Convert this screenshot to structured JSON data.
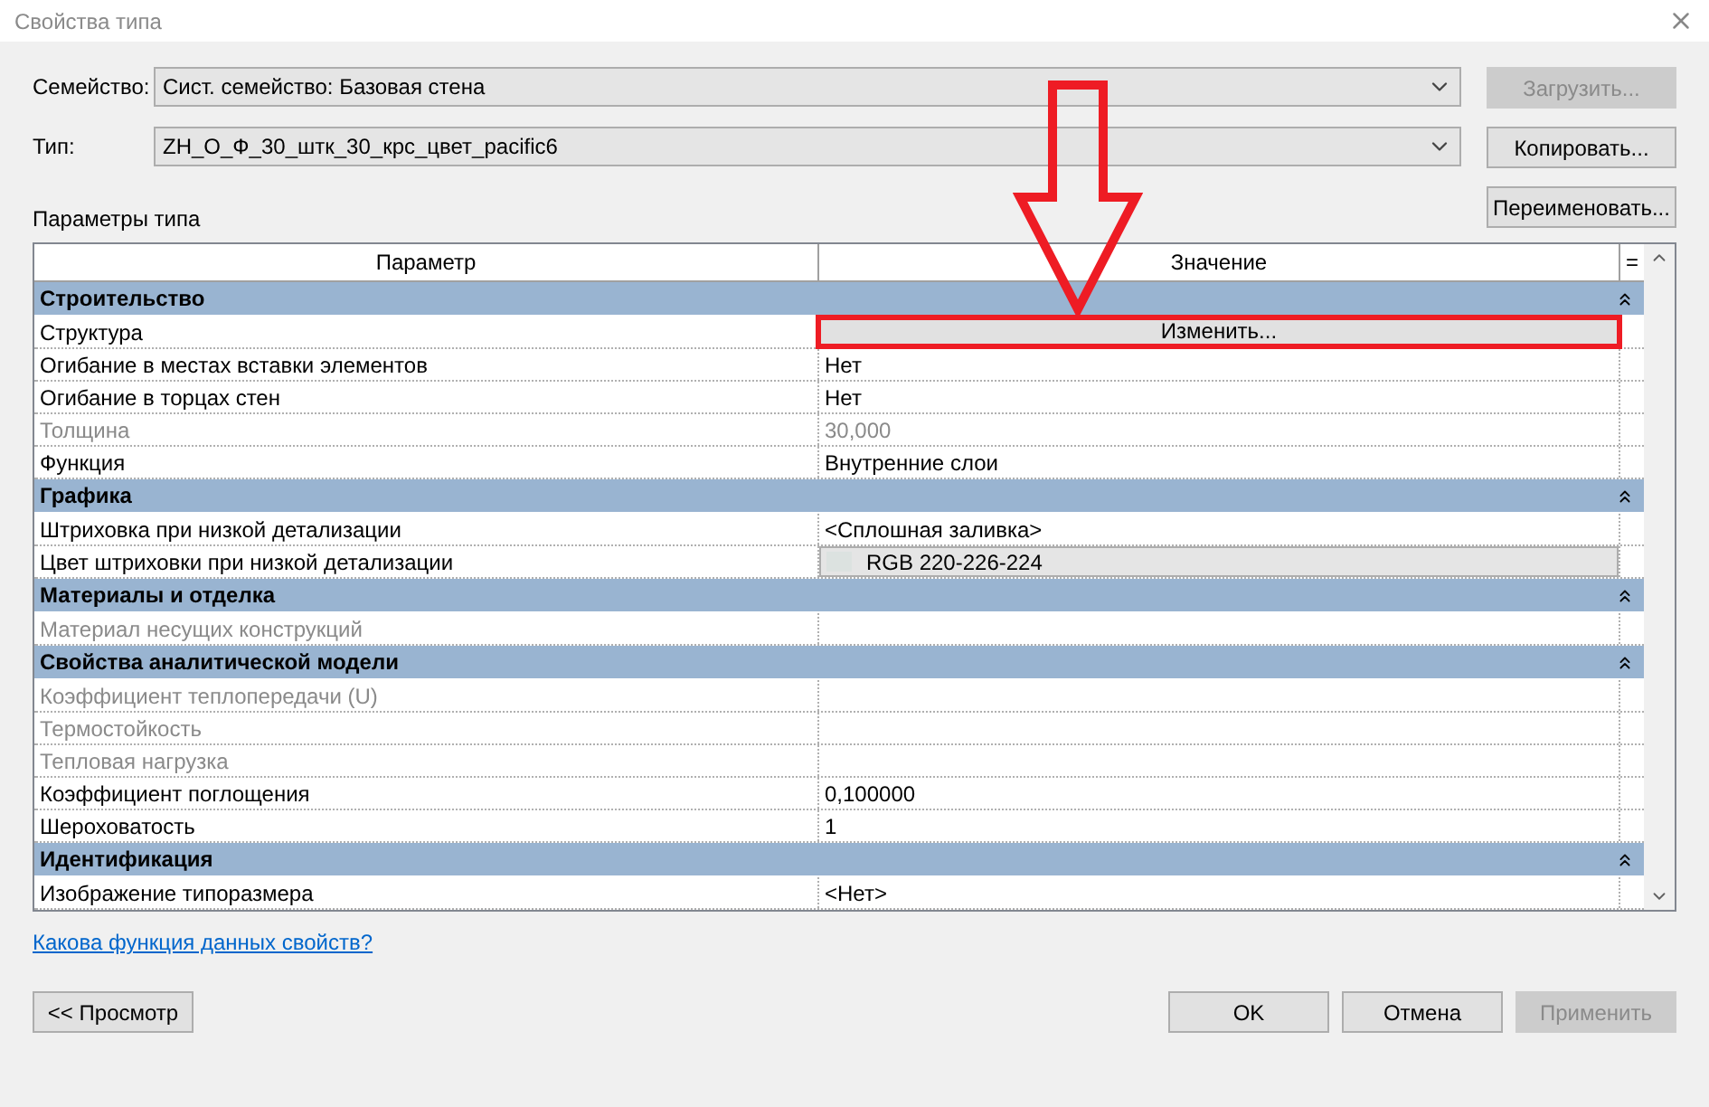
{
  "window": {
    "title": "Свойства типа"
  },
  "family": {
    "label": "Семейство:",
    "value": "Сист. семейство: Базовая стена"
  },
  "type": {
    "label": "Тип:",
    "value": "ZH_О_Ф_30_штк_30_крс_цвет_pacific6"
  },
  "side_buttons": [
    {
      "label": "Загрузить...",
      "disabled": true
    },
    {
      "label": "Копировать...",
      "disabled": false
    },
    {
      "label": "Переименовать...",
      "disabled": false
    }
  ],
  "section_label": "Параметры типа",
  "table": {
    "columns": [
      "Параметр",
      "Значение",
      "="
    ],
    "groups": [
      {
        "title": "Строительство",
        "expanded": true,
        "rows": [
          {
            "name": "Структура",
            "value": "Изменить...",
            "kind": "button",
            "disabled": false,
            "highlighted": true
          },
          {
            "name": "Огибание в местах вставки элементов",
            "value": "Нет",
            "kind": "text",
            "disabled": false,
            "highlighted": false
          },
          {
            "name": "Огибание в торцах стен",
            "value": "Нет",
            "kind": "text",
            "disabled": false,
            "highlighted": false
          },
          {
            "name": "Толщина",
            "value": "30,000",
            "kind": "text",
            "disabled": true,
            "highlighted": false
          },
          {
            "name": "Функция",
            "value": "Внутренние слои",
            "kind": "text",
            "disabled": false,
            "highlighted": false
          }
        ]
      },
      {
        "title": "Графика",
        "expanded": true,
        "rows": [
          {
            "name": "Штриховка при низкой детализации",
            "value": "<Сплошная заливка>",
            "kind": "text",
            "disabled": false,
            "highlighted": false
          },
          {
            "name": "Цвет штриховки при низкой детализации",
            "value": "RGB 220-226-224",
            "kind": "color",
            "disabled": false,
            "highlighted": false
          }
        ]
      },
      {
        "title": "Материалы и отделка",
        "expanded": true,
        "rows": [
          {
            "name": "Материал несущих конструкций",
            "value": "",
            "kind": "text",
            "disabled": true,
            "highlighted": false
          }
        ]
      },
      {
        "title": "Свойства аналитической модели",
        "expanded": true,
        "rows": [
          {
            "name": "Коэффициент теплопередачи (U)",
            "value": "",
            "kind": "text",
            "disabled": true,
            "highlighted": false
          },
          {
            "name": "Термостойкость",
            "value": "",
            "kind": "text",
            "disabled": true,
            "highlighted": false
          },
          {
            "name": "Тепловая нагрузка",
            "value": "",
            "kind": "text",
            "disabled": true,
            "highlighted": false
          },
          {
            "name": "Коэффициент поглощения",
            "value": "0,100000",
            "kind": "text",
            "disabled": false,
            "highlighted": false
          },
          {
            "name": "Шероховатость",
            "value": "1",
            "kind": "text",
            "disabled": false,
            "highlighted": false
          }
        ]
      },
      {
        "title": "Идентификация",
        "expanded": true,
        "rows": [
          {
            "name": "Изображение типоразмера",
            "value": "<Нет>",
            "kind": "text",
            "disabled": false,
            "highlighted": false
          }
        ]
      }
    ]
  },
  "help_link": "Какова функция данных свойств?",
  "preview_button": {
    "label": "<< Просмотр",
    "disabled": false
  },
  "footer_buttons": [
    {
      "label": "OK",
      "disabled": false
    },
    {
      "label": "Отмена",
      "disabled": false
    },
    {
      "label": "Применить",
      "disabled": true
    }
  ]
}
